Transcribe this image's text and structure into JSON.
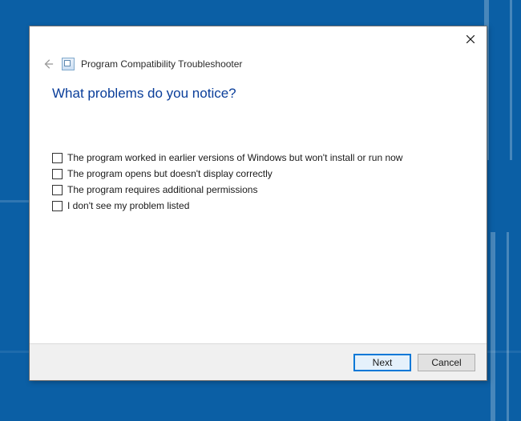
{
  "app": {
    "title": "Program Compatibility Troubleshooter"
  },
  "heading": "What problems do you notice?",
  "options": [
    {
      "label": "The program worked in earlier versions of Windows but won't install or run now"
    },
    {
      "label": "The program opens but doesn't display correctly"
    },
    {
      "label": "The program requires additional permissions"
    },
    {
      "label": "I don't see my problem listed"
    }
  ],
  "buttons": {
    "next": "Next",
    "cancel": "Cancel"
  }
}
